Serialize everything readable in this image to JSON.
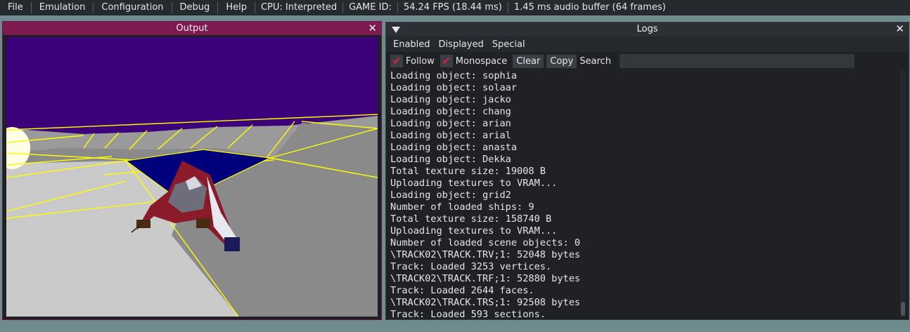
{
  "menubar": {
    "items": [
      "File",
      "Emulation",
      "Configuration",
      "Debug",
      "Help"
    ],
    "cpu": "CPU: Interpreted",
    "game_id": "GAME ID:",
    "fps": "54.24 FPS (18.44 ms)",
    "audio": "1.45 ms audio buffer (64 frames)"
  },
  "output": {
    "title": "Output",
    "close": "✕"
  },
  "logs": {
    "title": "Logs",
    "close": "✕",
    "menu": [
      "Enabled",
      "Displayed",
      "Special"
    ],
    "follow_label": "Follow",
    "monospace_label": "Monospace",
    "clear_label": "Clear",
    "copy_label": "Copy",
    "search_label": "Search",
    "search_value": "",
    "lines": [
      "Loading object: sophia",
      "Loading object: solaar",
      "Loading object: jacko",
      "Loading object: chang",
      "Loading object: arian",
      "Loading object: arial",
      "Loading object: anasta",
      "Loading object: Dekka",
      "Total texture size: 19008 B",
      "Uploading textures to VRAM...",
      "Loading object: grid2",
      "Number of loaded ships: 9",
      "Total texture size: 158740 B",
      "Uploading textures to VRAM...",
      "Number of loaded scene objects: 0",
      "\\TRACK02\\TRACK.TRV;1: 52048 bytes",
      "Track: Loaded 3253 vertices.",
      "\\TRACK02\\TRACK.TRF;1: 52880 bytes",
      "Track: Loaded 2644 faces.",
      "\\TRACK02\\TRACK.TRS;1: 92508 bytes",
      "Track: Loaded 593 sections."
    ]
  },
  "colors": {
    "sky": "#3b007a",
    "wall": "#c8c8c8",
    "track": "#8a8a8a",
    "grid_line": "#ffff00",
    "ship_canopy": "#00007c",
    "ship_body": "#8b1a2a"
  }
}
